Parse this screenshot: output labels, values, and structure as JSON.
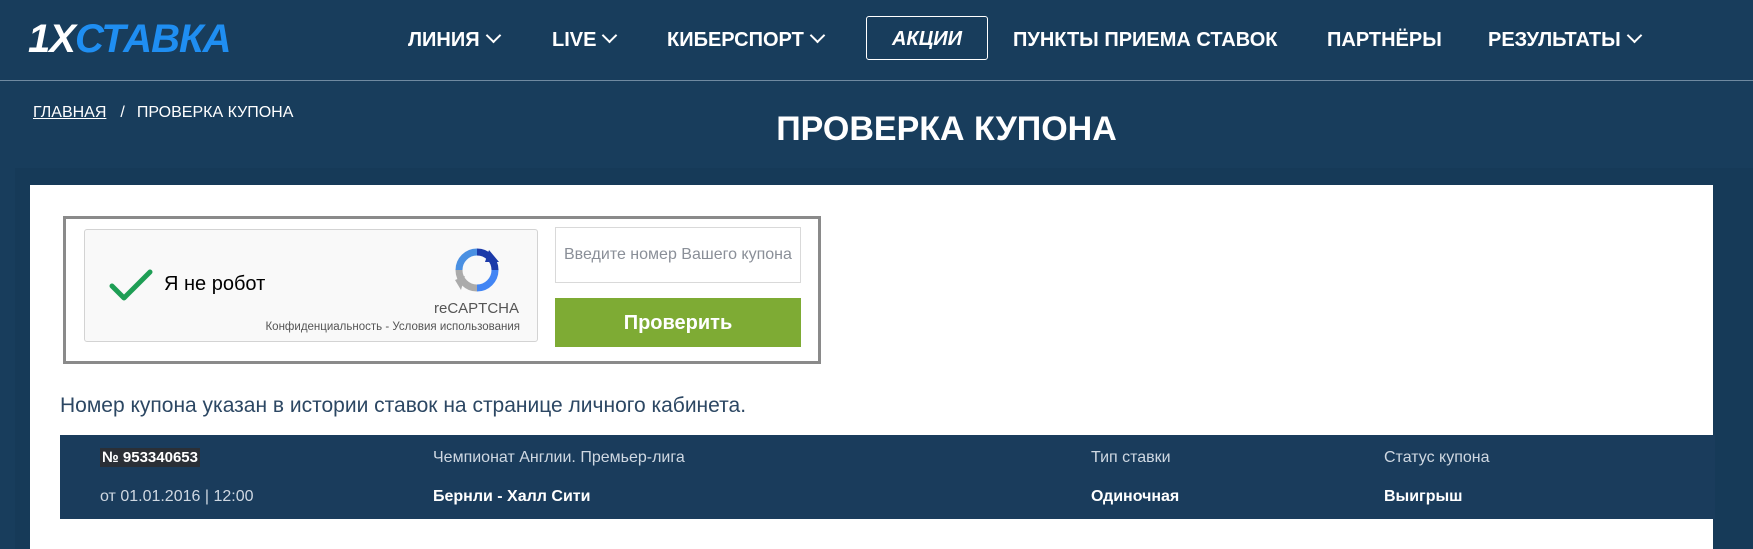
{
  "header": {
    "logo_part1": "1X",
    "logo_part2": "СТАВКА",
    "nav": {
      "line": "ЛИНИЯ",
      "live": "LIVE",
      "esports": "КИБЕРСПОРТ",
      "promos": "АКЦИИ",
      "points": "ПУНКТЫ ПРИЕМА СТАВОК",
      "partners": "ПАРТНЁРЫ",
      "results": "РЕЗУЛЬТАТЫ"
    }
  },
  "breadcrumb": {
    "home": "ГЛАВНАЯ",
    "separator": "/",
    "current": "ПРОВЕРКА КУПОНА"
  },
  "page_title": "ПРОВЕРКА КУПОНА",
  "captcha": {
    "label": "Я не робот",
    "brand": "reCAPTCHA",
    "links": "Конфиденциальность - Условия использования",
    "checked": true
  },
  "form": {
    "coupon_placeholder": "Введите номер Вашего купона",
    "coupon_value": "",
    "submit_label": "Проверить"
  },
  "hint": "Номер купона указан в истории ставок на странице личного кабинета.",
  "result": {
    "coupon_number": "№ 953340653",
    "date": "от 01.01.2016 | 12:00",
    "league": "Чемпионат Англии. Премьер-лига",
    "match": "Бернли - Халл Сити",
    "bet_type_label": "Тип ставки",
    "bet_type_value": "Одиночная",
    "status_label": "Статус купона",
    "status_value": "Выигрыш"
  },
  "colors": {
    "background": "#183d5c",
    "logo_accent": "#1f8ef1",
    "button": "#7eab34",
    "check": "#1e9e55"
  }
}
